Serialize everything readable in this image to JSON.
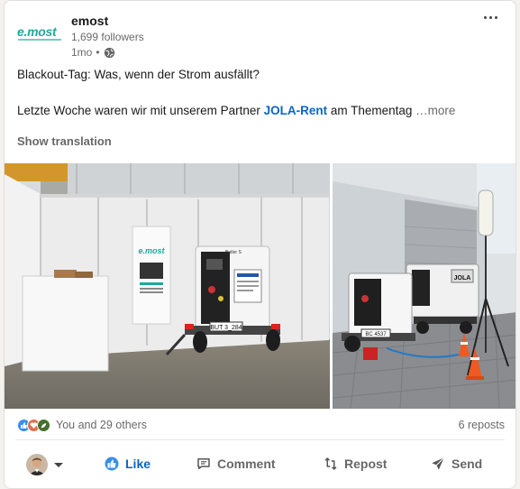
{
  "post": {
    "author": {
      "name": "emost",
      "logo_text": "e.most",
      "followers": "1,699 followers",
      "age": "1mo",
      "separator": "•"
    },
    "text": {
      "line1": "Blackout-Tag: Was, wenn der Strom ausfällt?",
      "line2_before": "Letzte Woche waren wir mit unserem Partner ",
      "mention": "JOLA-Rent",
      "line2_after": " am Thementag ",
      "see_more": "…more"
    },
    "show_translation": "Show translation",
    "images": {
      "left": {
        "banner_logo": "e.most",
        "generator_label": "Butler S",
        "plate": "BUT 3_284",
        "generator_brand": "emost"
      },
      "right": {
        "generator_brand": "JOLA",
        "plate": "BC 4537"
      }
    },
    "social": {
      "reactions": [
        "like-reaction",
        "love-reaction",
        "support-reaction"
      ],
      "reactors": "You and 29 others",
      "reposts": "6 reposts"
    },
    "actions": {
      "like": "Like",
      "comment": "Comment",
      "repost": "Repost",
      "send": "Send"
    }
  },
  "colors": {
    "brand": "#1ea99a",
    "link": "#0a66c2",
    "muted": "#666666"
  }
}
